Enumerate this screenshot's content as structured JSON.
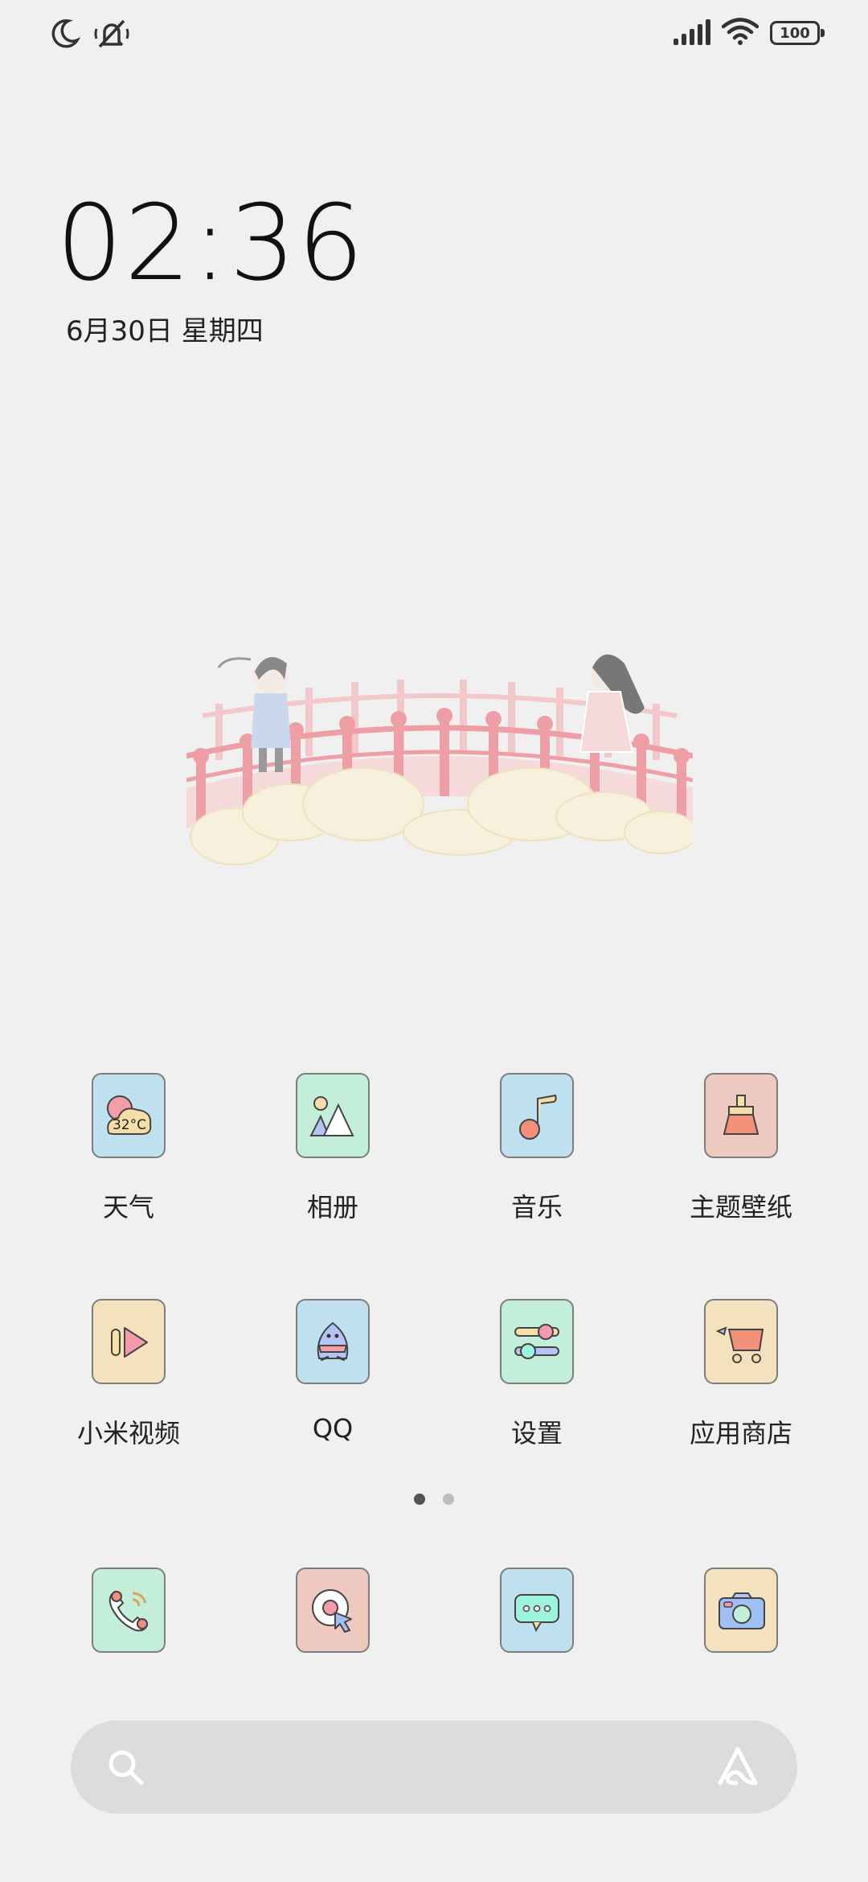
{
  "status_bar": {
    "left_icons": [
      "moon-icon",
      "mute-icon"
    ],
    "right_icons": [
      "signal-icon",
      "wifi-icon",
      "battery-icon"
    ],
    "battery": "100"
  },
  "clock": {
    "time": "02:36",
    "date": "6月30日 星期四"
  },
  "apps": [
    {
      "label": "天气",
      "icon": "weather-icon",
      "bg": "#bfe1ef",
      "temp": "32°C"
    },
    {
      "label": "相册",
      "icon": "gallery-icon",
      "bg": "#c3eed9"
    },
    {
      "label": "音乐",
      "icon": "music-icon",
      "bg": "#bfe1ef"
    },
    {
      "label": "主题壁纸",
      "icon": "themes-icon",
      "bg": "#eec9bf"
    },
    {
      "label": "小米视频",
      "icon": "video-icon",
      "bg": "#f3e2bd"
    },
    {
      "label": "QQ",
      "icon": "qq-icon",
      "bg": "#bfe1ef"
    },
    {
      "label": "设置",
      "icon": "settings-icon",
      "bg": "#c3eed9"
    },
    {
      "label": "应用商店",
      "icon": "app-store-icon",
      "bg": "#f3e2bd"
    }
  ],
  "page_indicator": {
    "pages": 2,
    "current": 1
  },
  "dock": [
    {
      "icon": "phone-icon",
      "bg": "#c3eed9"
    },
    {
      "icon": "browser-icon",
      "bg": "#eec9bf"
    },
    {
      "icon": "messages-icon",
      "bg": "#bfe1ef"
    },
    {
      "icon": "camera-icon",
      "bg": "#f3e2bd"
    }
  ],
  "search_bar": {
    "left_icon": "search-icon",
    "right_icon": "assistant-icon"
  }
}
